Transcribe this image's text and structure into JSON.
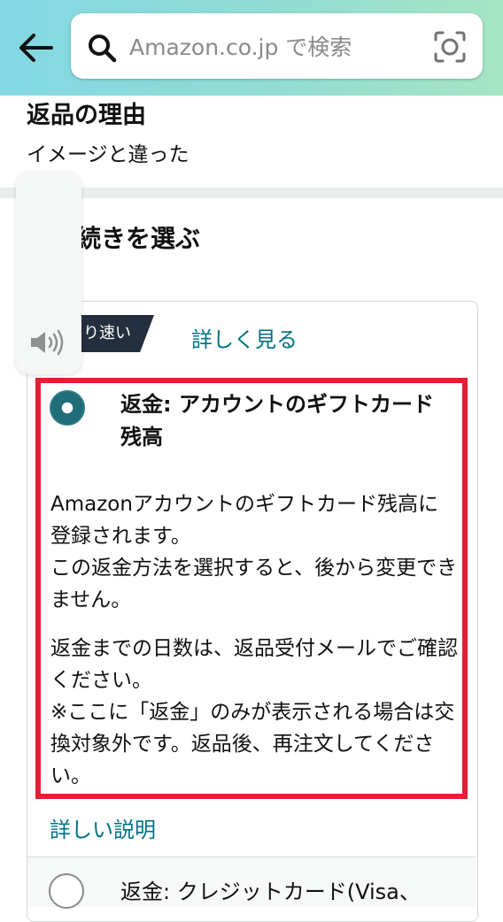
{
  "search": {
    "placeholder": "Amazon.co.jp で検索"
  },
  "icons": {
    "back": "arrow-left",
    "search": "magnifier",
    "camera": "camera-scan",
    "speaker": "volume"
  },
  "return_reason": {
    "title": "返品の理由",
    "value": "イメージと違った"
  },
  "section": {
    "title": "な手続きを選ぶ"
  },
  "speed_badge": "り速い",
  "details_link": "詳しく見る",
  "options": [
    {
      "title": "返金: アカウントのギフトカード残高",
      "selected": true,
      "description": "Amazonアカウントのギフトカード残高に登録されます。\nこの返金方法を選択すると、後から変更できません。",
      "note": "返金までの日数は、返品受付メールでご確認ください。\n※ここに「返金」のみが表示される場合は交換対象外です。返品後、再注文してください。",
      "detail_link": "詳しい説明"
    },
    {
      "title": "返金: クレジットカード(Visa、",
      "selected": false
    }
  ],
  "colors": {
    "header_gradient_start": "#82d8e3",
    "header_gradient_end": "#a6e5c4",
    "link": "#007185",
    "highlight_border": "#e41e35",
    "radio_selected": "#1e6d78",
    "badge_bg": "#232f3e"
  }
}
